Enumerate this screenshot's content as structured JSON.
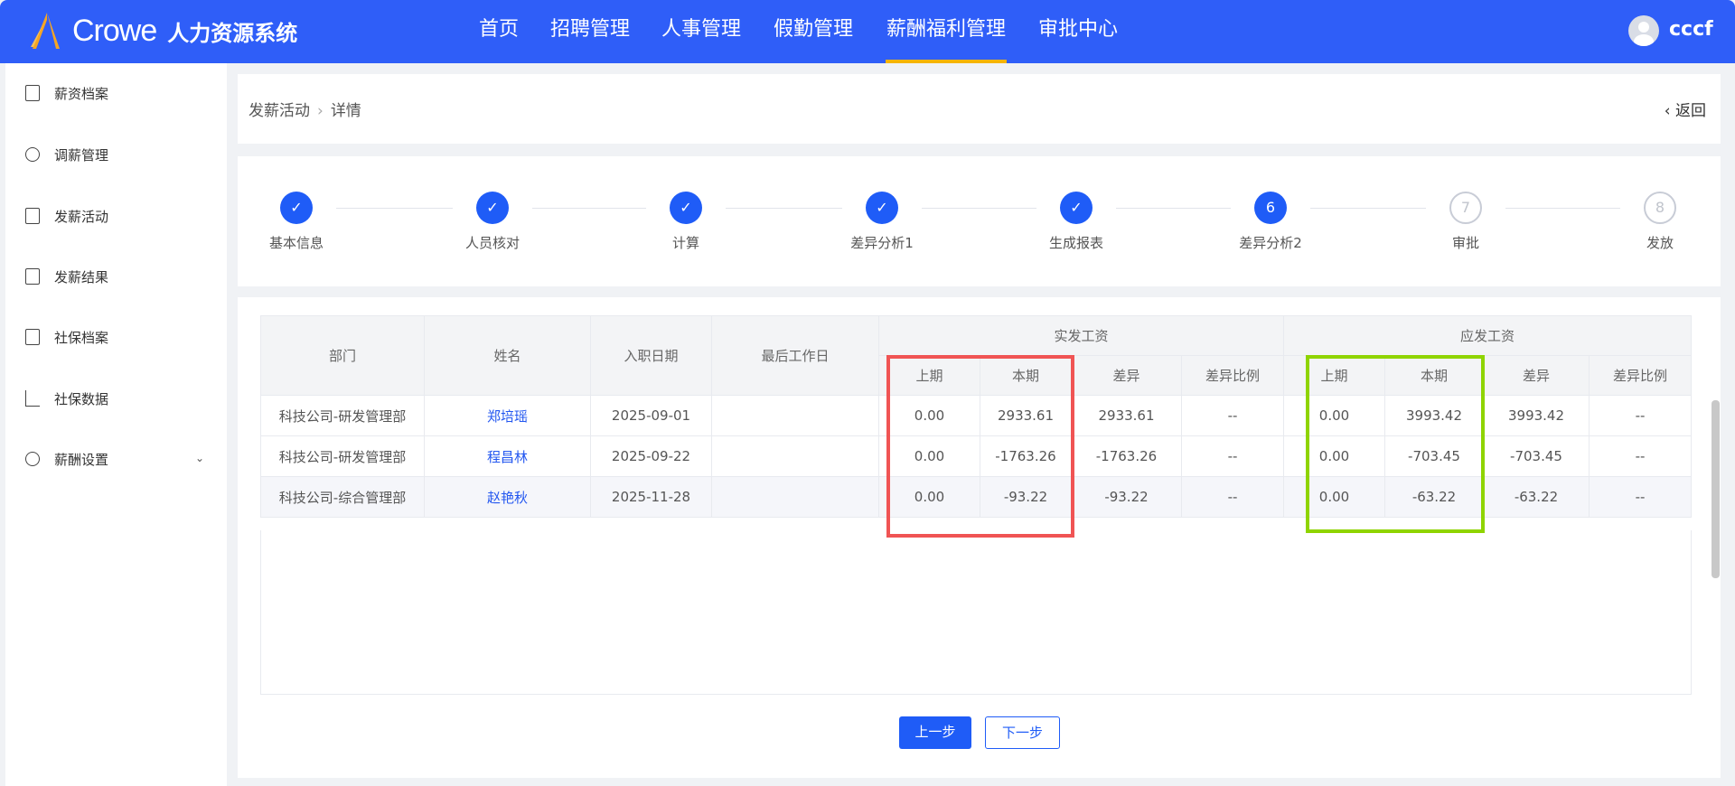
{
  "header": {
    "brand": "Crowe",
    "system_name": "人力资源系统",
    "nav": [
      "首页",
      "招聘管理",
      "人事管理",
      "假勤管理",
      "薪酬福利管理",
      "审批中心"
    ],
    "active_nav": "薪酬福利管理",
    "user": "cccf"
  },
  "sidebar": {
    "items": [
      {
        "label": "薪资档案",
        "icon": "file-icon"
      },
      {
        "label": "调薪管理",
        "icon": "exchange-icon"
      },
      {
        "label": "发薪活动",
        "icon": "clipboard-icon"
      },
      {
        "label": "发薪结果",
        "icon": "check-clipboard-icon"
      },
      {
        "label": "社保档案",
        "icon": "grid-icon"
      },
      {
        "label": "社保数据",
        "icon": "bar-chart-icon"
      },
      {
        "label": "薪酬设置",
        "icon": "gear-icon"
      }
    ]
  },
  "breadcrumb": {
    "parent": "发薪活动",
    "current": "详情",
    "back": "返回"
  },
  "steps": [
    {
      "label": "基本信息",
      "num": "1",
      "status": "done"
    },
    {
      "label": "人员核对",
      "num": "2",
      "status": "done"
    },
    {
      "label": "计算",
      "num": "3",
      "status": "done"
    },
    {
      "label": "差异分析1",
      "num": "4",
      "status": "done"
    },
    {
      "label": "生成报表",
      "num": "5",
      "status": "done"
    },
    {
      "label": "差异分析2",
      "num": "6",
      "status": "current"
    },
    {
      "label": "审批",
      "num": "7",
      "status": "wait"
    },
    {
      "label": "发放",
      "num": "8",
      "status": "wait"
    }
  ],
  "table": {
    "headers": {
      "dept": "部门",
      "name": "姓名",
      "join_date": "入职日期",
      "last_day": "最后工作日",
      "actual": "实发工资",
      "payable": "应发工资",
      "prev": "上期",
      "curr": "本期",
      "diff": "差异",
      "ratio": "差异比例"
    },
    "rows": [
      {
        "dept": "科技公司-研发管理部",
        "name": "郑培瑶",
        "join_date": "2025-09-01",
        "last_day": "",
        "a_prev": "0.00",
        "a_curr": "2933.61",
        "a_diff": "2933.61",
        "a_ratio": "--",
        "p_prev": "0.00",
        "p_curr": "3993.42",
        "p_diff": "3993.42",
        "p_ratio": "--"
      },
      {
        "dept": "科技公司-研发管理部",
        "name": "程昌林",
        "join_date": "2025-09-22",
        "last_day": "",
        "a_prev": "0.00",
        "a_curr": "-1763.26",
        "a_diff": "-1763.26",
        "a_ratio": "--",
        "p_prev": "0.00",
        "p_curr": "-703.45",
        "p_diff": "-703.45",
        "p_ratio": "--"
      },
      {
        "dept": "科技公司-综合管理部",
        "name": "赵艳秋",
        "join_date": "2025-11-28",
        "last_day": "",
        "a_prev": "0.00",
        "a_curr": "-93.22",
        "a_diff": "-93.22",
        "a_ratio": "--",
        "p_prev": "0.00",
        "p_curr": "-63.22",
        "p_diff": "-63.22",
        "p_ratio": "--"
      }
    ]
  },
  "buttons": {
    "prev": "上一步",
    "next": "下一步"
  },
  "colors": {
    "primary": "#2f5ef8",
    "active_underline": "#f5b400",
    "highlight_red": "#f05454",
    "highlight_green": "#8fd400"
  }
}
